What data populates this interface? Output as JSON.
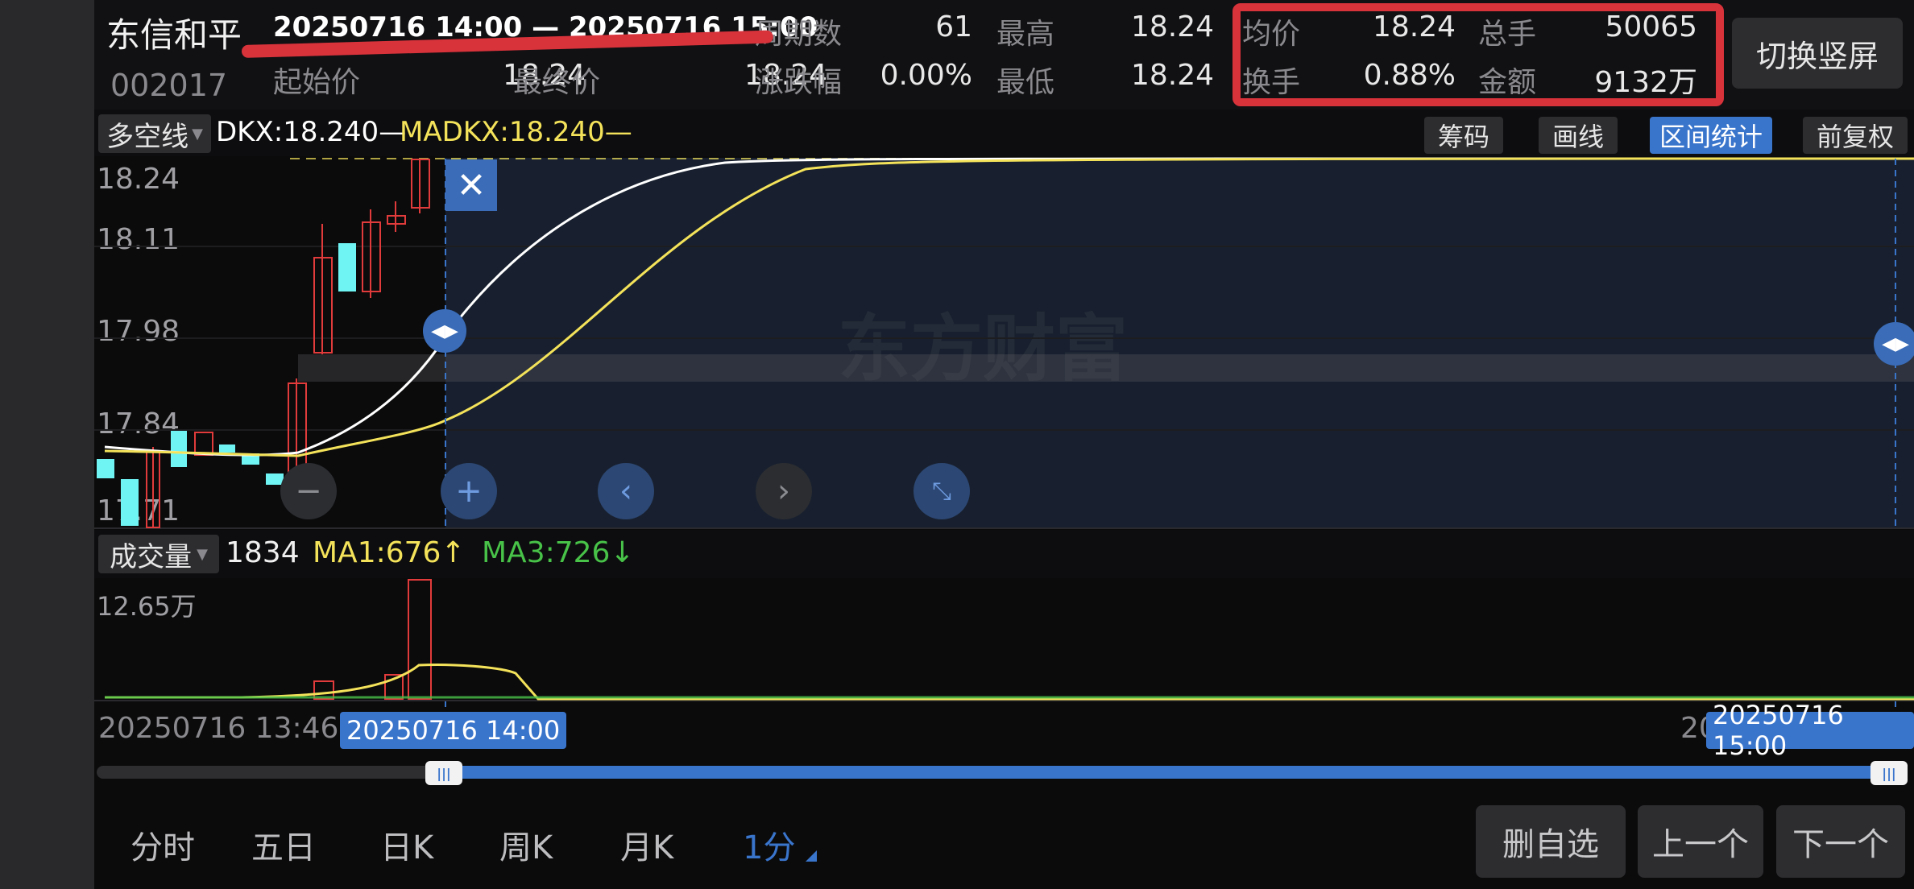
{
  "stock": {
    "name": "东信和平",
    "code": "002017"
  },
  "range": {
    "text": "20250716 14:00 — 20250716 15:00"
  },
  "stats": {
    "start_price_label": "起始价",
    "start_price": "18.24",
    "end_price_label": "最终价",
    "end_price": "18.24",
    "periods_label": "周期数",
    "periods": "61",
    "change_label": "涨跌幅",
    "change": "0.00%",
    "high_label": "最高",
    "high": "18.24",
    "low_label": "最低",
    "low": "18.24",
    "avg_label": "均价",
    "avg": "18.24",
    "turnover_label": "换手",
    "turnover": "0.88%",
    "total_vol_label": "总手",
    "total_vol": "50065",
    "amount_label": "金额",
    "amount": "9132万"
  },
  "switch_portrait": "切换竖屏",
  "indicator": {
    "name": "多空线",
    "dkx": "DKX:18.240—",
    "madkx": "MADKX:18.240—"
  },
  "toolbar": {
    "chips": "筹码",
    "draw": "画线",
    "interval_stats": "区间统计",
    "adjust": "前复权"
  },
  "price_axis": [
    "18.24",
    "18.11",
    "17.98",
    "17.84",
    "17.71"
  ],
  "volume": {
    "name": "成交量",
    "value": "1834",
    "ma1": "MA1:676↑",
    "ma3": "MA3:726↓",
    "axis_max": "12.65万"
  },
  "time_axis": {
    "left": "20250716 13:46",
    "sel_start": "20250716 14:00",
    "right_partial": "20",
    "sel_end": "20250716 15:00"
  },
  "period_tabs": [
    "分时",
    "五日",
    "日K",
    "周K",
    "月K",
    "1分"
  ],
  "actions": {
    "remove_watch": "删自选",
    "prev": "上一个",
    "next": "下一个"
  },
  "watermark": "东方财富",
  "colors": {
    "up": "#e23b3b",
    "down": "#6ff3f3",
    "selected": "#3a75cc",
    "dkx": "#ffffff",
    "madkx": "#f4e35a",
    "ma3": "#48c248",
    "annotation": "#d8323b"
  }
}
